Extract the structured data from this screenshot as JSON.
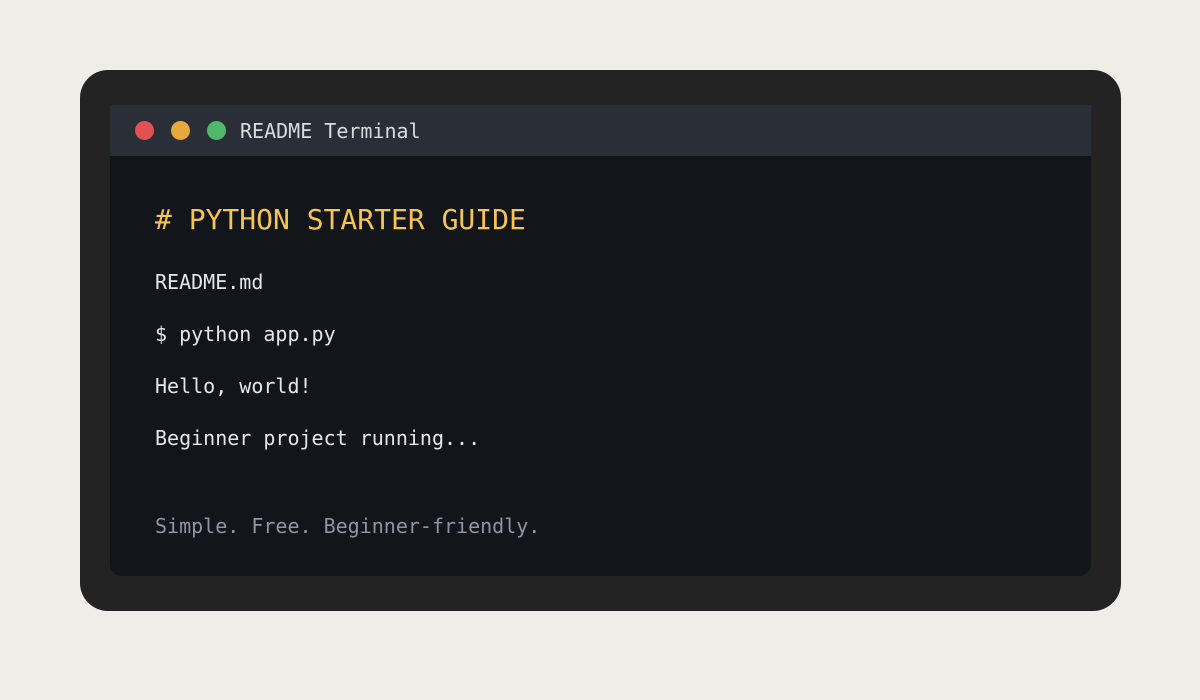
{
  "window": {
    "title": "README Terminal",
    "controls": {
      "close": "close-dot",
      "minimize": "minimize-dot",
      "maximize": "maximize-dot"
    }
  },
  "terminal": {
    "heading": "# PYTHON STARTER GUIDE",
    "lines": [
      "README.md",
      "$ python app.py",
      "Hello, world!",
      "Beginner project running..."
    ],
    "tagline": "Simple. Free. Beginner-friendly."
  },
  "colors": {
    "page_background": "#efede8",
    "bezel": "#232323",
    "terminal_background": "#12151a",
    "titlebar": "#2a2e36",
    "heading": "#f5c451",
    "text": "#e4e6ea",
    "muted_text": "#8f96a0",
    "close": "#e05252",
    "minimize": "#e8a83c",
    "maximize": "#4fb86b"
  }
}
